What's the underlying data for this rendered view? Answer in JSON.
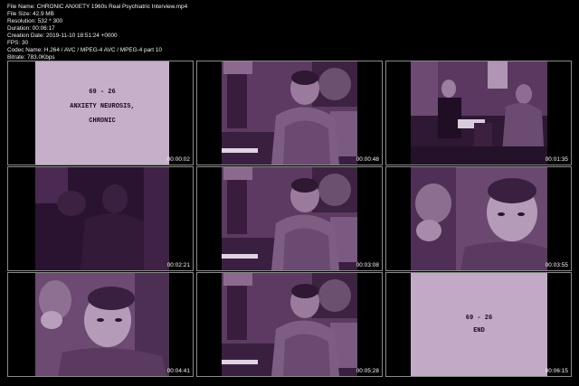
{
  "metadata": {
    "file_name": "File Name: CHRONIC ANXIETY  1960s Real Psychiatric Interview.mp4",
    "file_size": "File Size: 42.9 MB",
    "resolution": "Resolution: 532 * 300",
    "duration": "Duration: 00:06:17",
    "creation_date": "Creation Date: 2019-11-10 18:51:24 +0000",
    "fps": "FPS: 30",
    "codec": "Codec Name: H.264 / AVC / MPEG-4 AVC / MPEG-4 part 10",
    "bitrate": "Bitrate: 783.0Kbps"
  },
  "thumbnails": [
    {
      "timestamp": "00:00:02",
      "scene": "title-card",
      "card_line1": "69 - 26",
      "card_line2": "ANXIETY NEUROSIS,",
      "card_line3": "CHRONIC"
    },
    {
      "timestamp": "00:00:48",
      "scene": "patient-seated"
    },
    {
      "timestamp": "00:01:35",
      "scene": "doctor-and-patient"
    },
    {
      "timestamp": "00:02:21",
      "scene": "dark-frame"
    },
    {
      "timestamp": "00:03:08",
      "scene": "patient-seated"
    },
    {
      "timestamp": "00:03:55",
      "scene": "patient-closeup"
    },
    {
      "timestamp": "00:04:41",
      "scene": "patient-closeup-left"
    },
    {
      "timestamp": "00:05:28",
      "scene": "patient-seated"
    },
    {
      "timestamp": "00:06:15",
      "scene": "end-card",
      "card_line1": "69 - 26",
      "card_line2": "END"
    }
  ],
  "colors": {
    "film_tint": "#6a4470",
    "card_paper": "#c9b3cc",
    "border": "#8a8a8a"
  }
}
